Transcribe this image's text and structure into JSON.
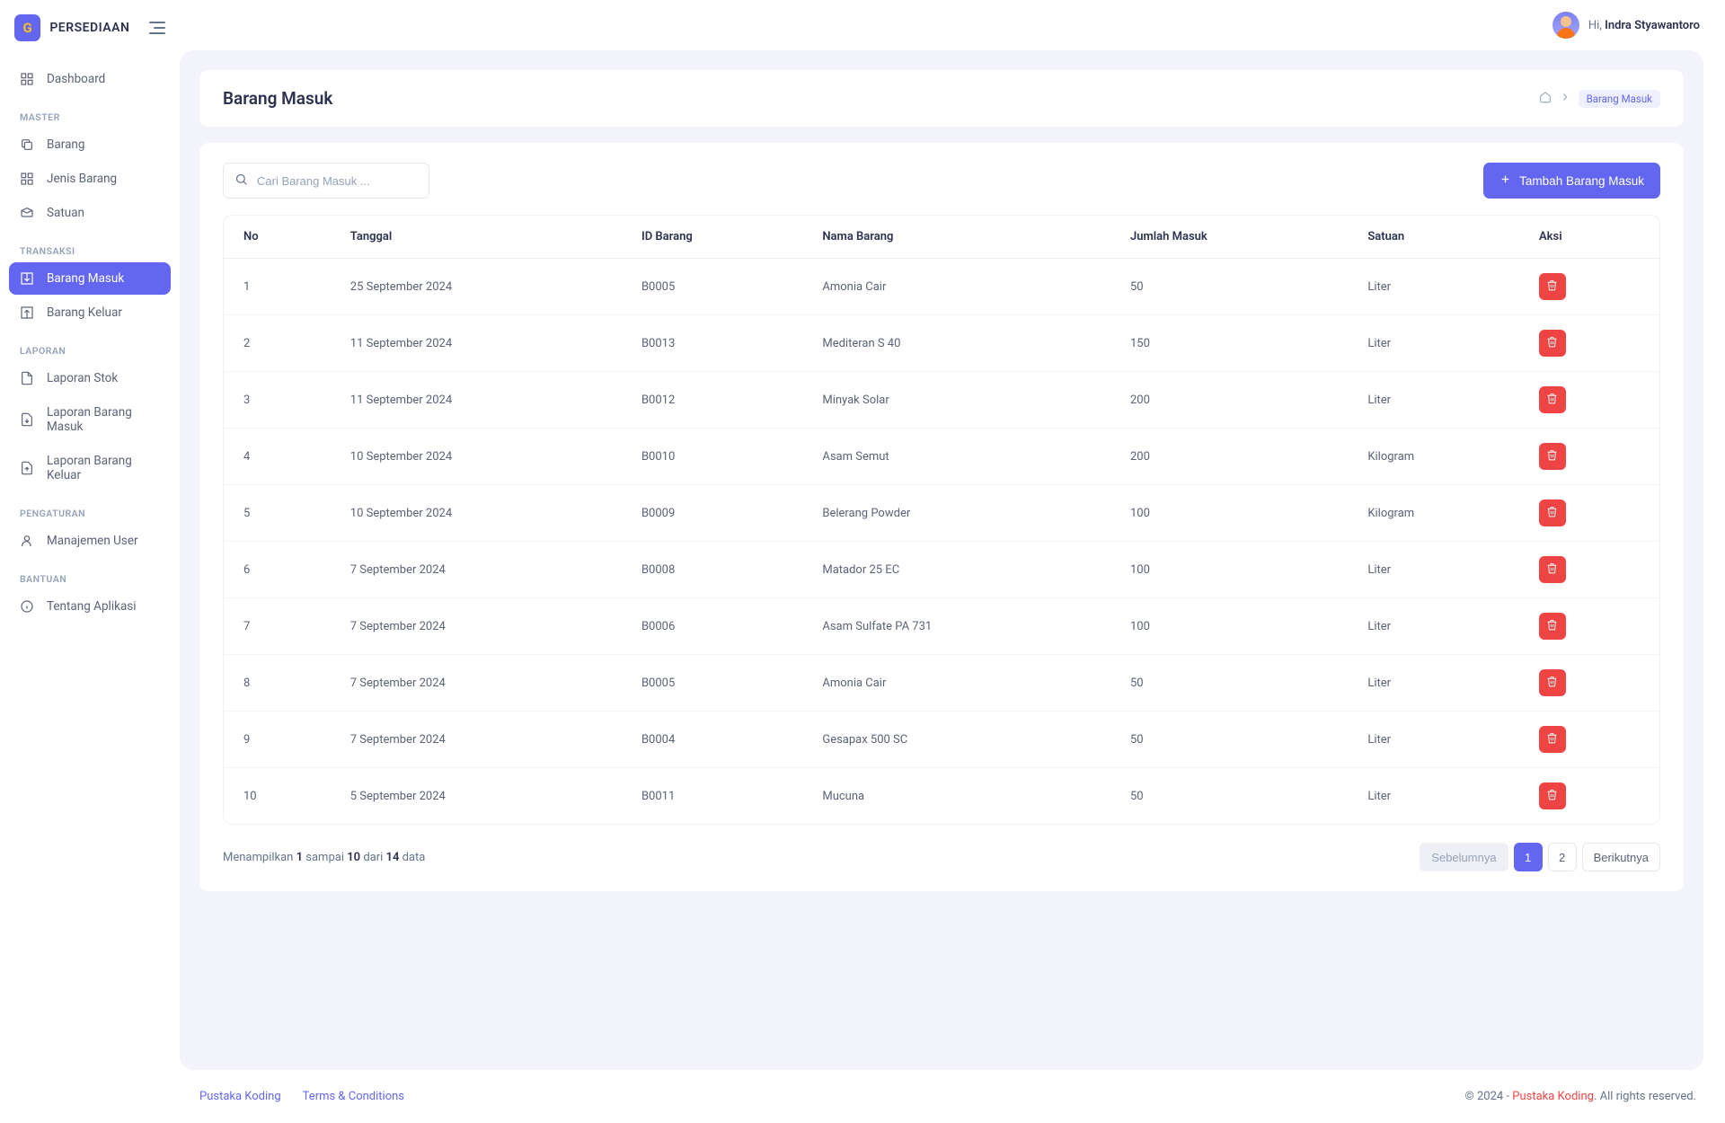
{
  "app_name": "PERSEDIAAN",
  "logo_letter": "G",
  "user": {
    "greeting": "Hi,",
    "name": "Indra Styawantoro"
  },
  "sidebar": {
    "dashboard": "Dashboard",
    "sections": {
      "master": {
        "title": "MASTER",
        "items": [
          "Barang",
          "Jenis Barang",
          "Satuan"
        ]
      },
      "transaksi": {
        "title": "TRANSAKSI",
        "items": [
          "Barang Masuk",
          "Barang Keluar"
        ]
      },
      "laporan": {
        "title": "LAPORAN",
        "items": [
          "Laporan Stok",
          "Laporan Barang Masuk",
          "Laporan Barang Keluar"
        ]
      },
      "pengaturan": {
        "title": "PENGATURAN",
        "items": [
          "Manajemen User"
        ]
      },
      "bantuan": {
        "title": "BANTUAN",
        "items": [
          "Tentang Aplikasi"
        ]
      }
    }
  },
  "page": {
    "title": "Barang Masuk",
    "breadcrumb_current": "Barang Masuk",
    "search_placeholder": "Cari Barang Masuk ...",
    "add_button": "Tambah Barang Masuk",
    "columns": [
      "No",
      "Tanggal",
      "ID Barang",
      "Nama Barang",
      "Jumlah Masuk",
      "Satuan",
      "Aksi"
    ],
    "rows": [
      {
        "no": "1",
        "tanggal": "25 September 2024",
        "id": "B0005",
        "nama": "Amonia Cair",
        "jumlah": "50",
        "satuan": "Liter"
      },
      {
        "no": "2",
        "tanggal": "11 September 2024",
        "id": "B0013",
        "nama": "Mediteran S 40",
        "jumlah": "150",
        "satuan": "Liter"
      },
      {
        "no": "3",
        "tanggal": "11 September 2024",
        "id": "B0012",
        "nama": "Minyak Solar",
        "jumlah": "200",
        "satuan": "Liter"
      },
      {
        "no": "4",
        "tanggal": "10 September 2024",
        "id": "B0010",
        "nama": "Asam Semut",
        "jumlah": "200",
        "satuan": "Kilogram"
      },
      {
        "no": "5",
        "tanggal": "10 September 2024",
        "id": "B0009",
        "nama": "Belerang Powder",
        "jumlah": "100",
        "satuan": "Kilogram"
      },
      {
        "no": "6",
        "tanggal": "7 September 2024",
        "id": "B0008",
        "nama": "Matador 25 EC",
        "jumlah": "100",
        "satuan": "Liter"
      },
      {
        "no": "7",
        "tanggal": "7 September 2024",
        "id": "B0006",
        "nama": "Asam Sulfate PA 731",
        "jumlah": "100",
        "satuan": "Liter"
      },
      {
        "no": "8",
        "tanggal": "7 September 2024",
        "id": "B0005",
        "nama": "Amonia Cair",
        "jumlah": "50",
        "satuan": "Liter"
      },
      {
        "no": "9",
        "tanggal": "7 September 2024",
        "id": "B0004",
        "nama": "Gesapax 500 SC",
        "jumlah": "50",
        "satuan": "Liter"
      },
      {
        "no": "10",
        "tanggal": "5 September 2024",
        "id": "B0011",
        "nama": "Mucuna",
        "jumlah": "50",
        "satuan": "Liter"
      }
    ],
    "summary": {
      "prefix": "Menampilkan",
      "from": "1",
      "mid1": "sampai",
      "to": "10",
      "mid2": "dari",
      "total": "14",
      "suffix": "data"
    },
    "pagination": {
      "prev": "Sebelumnya",
      "pages": [
        "1",
        "2"
      ],
      "next": "Berikutnya",
      "active": "1"
    }
  },
  "footer": {
    "links": [
      "Pustaka Koding",
      "Terms & Conditions"
    ],
    "copyright_prefix": "© 2024 -",
    "brand": "Pustaka Koding",
    "copyright_suffix": ". All rights reserved."
  }
}
